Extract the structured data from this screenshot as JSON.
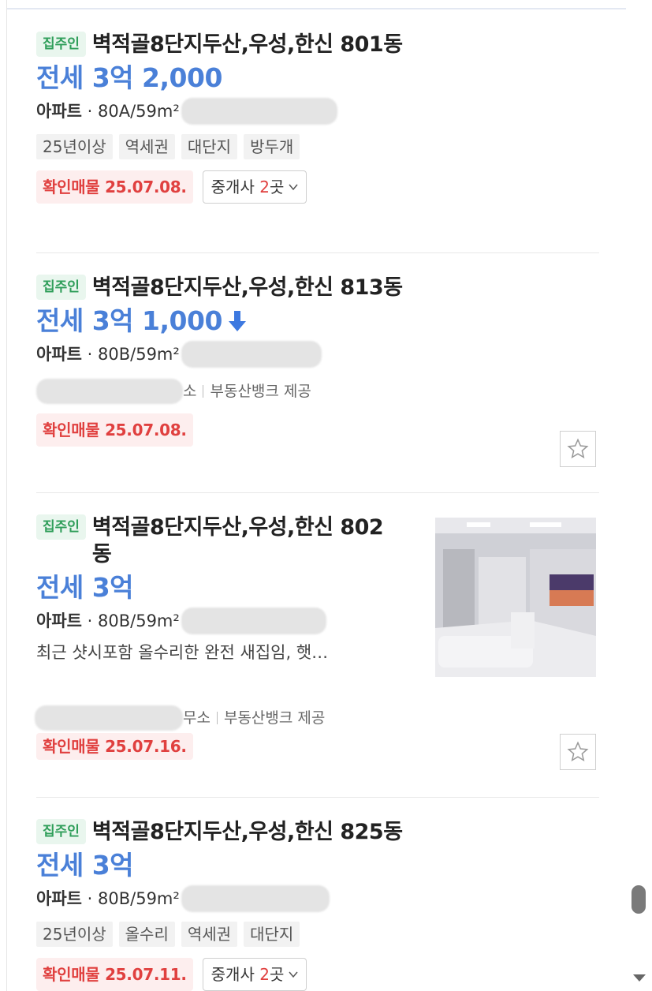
{
  "listings": [
    {
      "owner_badge": "집주인",
      "title": "벽적골8단지두산,우성,한신 801동",
      "price": "전세 3억 2,000",
      "spec_type": "아파트",
      "spec_area": "80A/59m²",
      "tags": [
        "25년이상",
        "역세권",
        "대단지",
        "방두개"
      ],
      "confirm": "확인매물 25.07.08.",
      "agent_label": "중개사",
      "agent_count": "2",
      "agent_suffix": "곳"
    },
    {
      "owner_badge": "집주인",
      "title": "벽적골8단지두산,우성,한신 813동",
      "price": "전세 3억 1,000",
      "spec_type": "아파트",
      "spec_area": "80B/59m²",
      "source_suffix": "소",
      "source": "부동산뱅크 제공",
      "confirm": "확인매물 25.07.08."
    },
    {
      "owner_badge": "집주인",
      "title": "벽적골8단지두산,우성,한신 802동",
      "price": "전세 3억",
      "spec_type": "아파트",
      "spec_area": "80B/59m²",
      "description": "최근 샷시포함 올수리한 완전 새집임, 햇…",
      "source_suffix": "무소",
      "source": "부동산뱅크 제공",
      "confirm": "확인매물 25.07.16."
    },
    {
      "owner_badge": "집주인",
      "title": "벽적골8단지두산,우성,한신 825동",
      "price": "전세 3억",
      "spec_type": "아파트",
      "spec_area": "80B/59m²",
      "tags": [
        "25년이상",
        "올수리",
        "역세권",
        "대단지"
      ],
      "confirm": "확인매물 25.07.11.",
      "agent_label": "중개사",
      "agent_count": "2",
      "agent_suffix": "곳"
    }
  ],
  "colors": {
    "price": "#4a80d8",
    "confirm_text": "#e0403f",
    "confirm_bg": "#fdeeee",
    "owner_badge_text": "#2f9e5a",
    "owner_badge_bg": "#e9f6ee"
  },
  "icons": {
    "price_down": "arrow-down-icon",
    "favorite": "star-outline-icon",
    "agent_expand": "chevron-down-icon"
  }
}
